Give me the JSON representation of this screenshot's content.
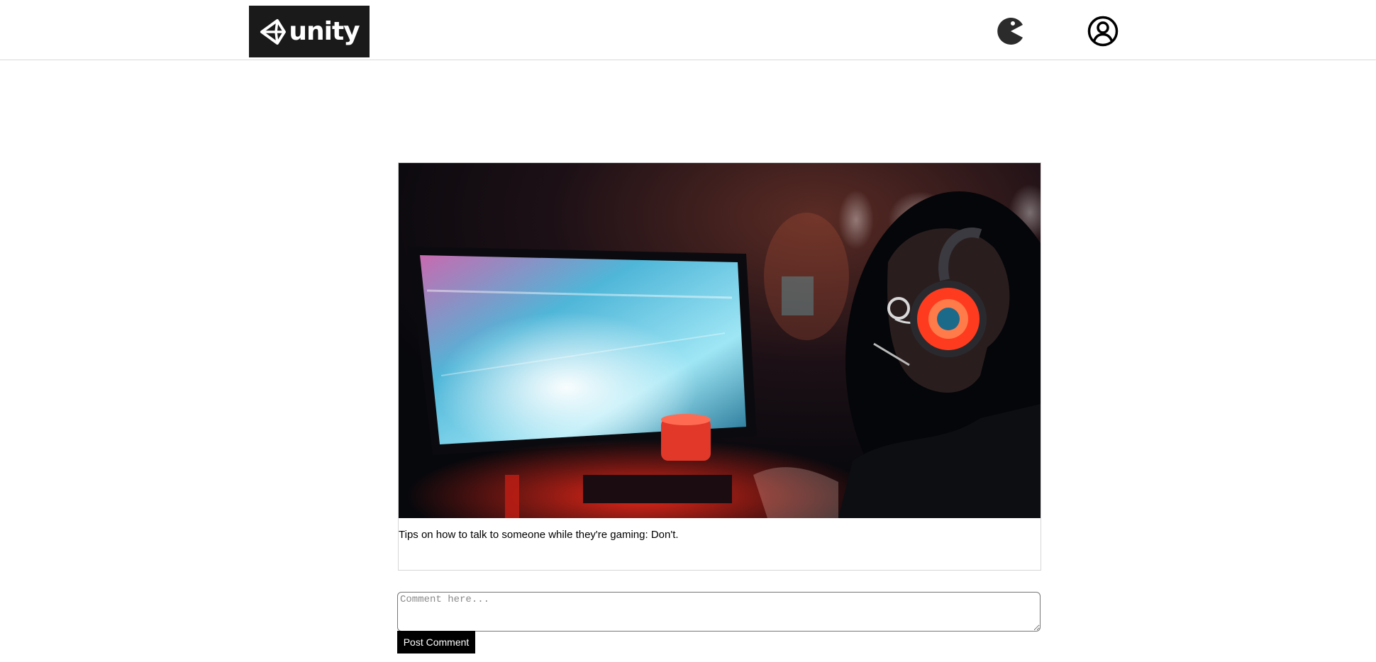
{
  "header": {
    "logo_text": "unity",
    "logo_icon": "unity-cube-icon",
    "game_icon": "pacman-icon",
    "profile_icon": "user-circle-icon"
  },
  "post": {
    "image_description": "gaming-setup-photo",
    "caption": "Tips on how to talk to someone while they're gaming: Don't."
  },
  "comment": {
    "placeholder": "Comment here...",
    "value": "",
    "submit_label": "Post Comment"
  },
  "colors": {
    "logo_bg": "#1a1a1a",
    "button_bg": "#000000",
    "button_text": "#ffffff",
    "border": "#d6d6d6"
  }
}
